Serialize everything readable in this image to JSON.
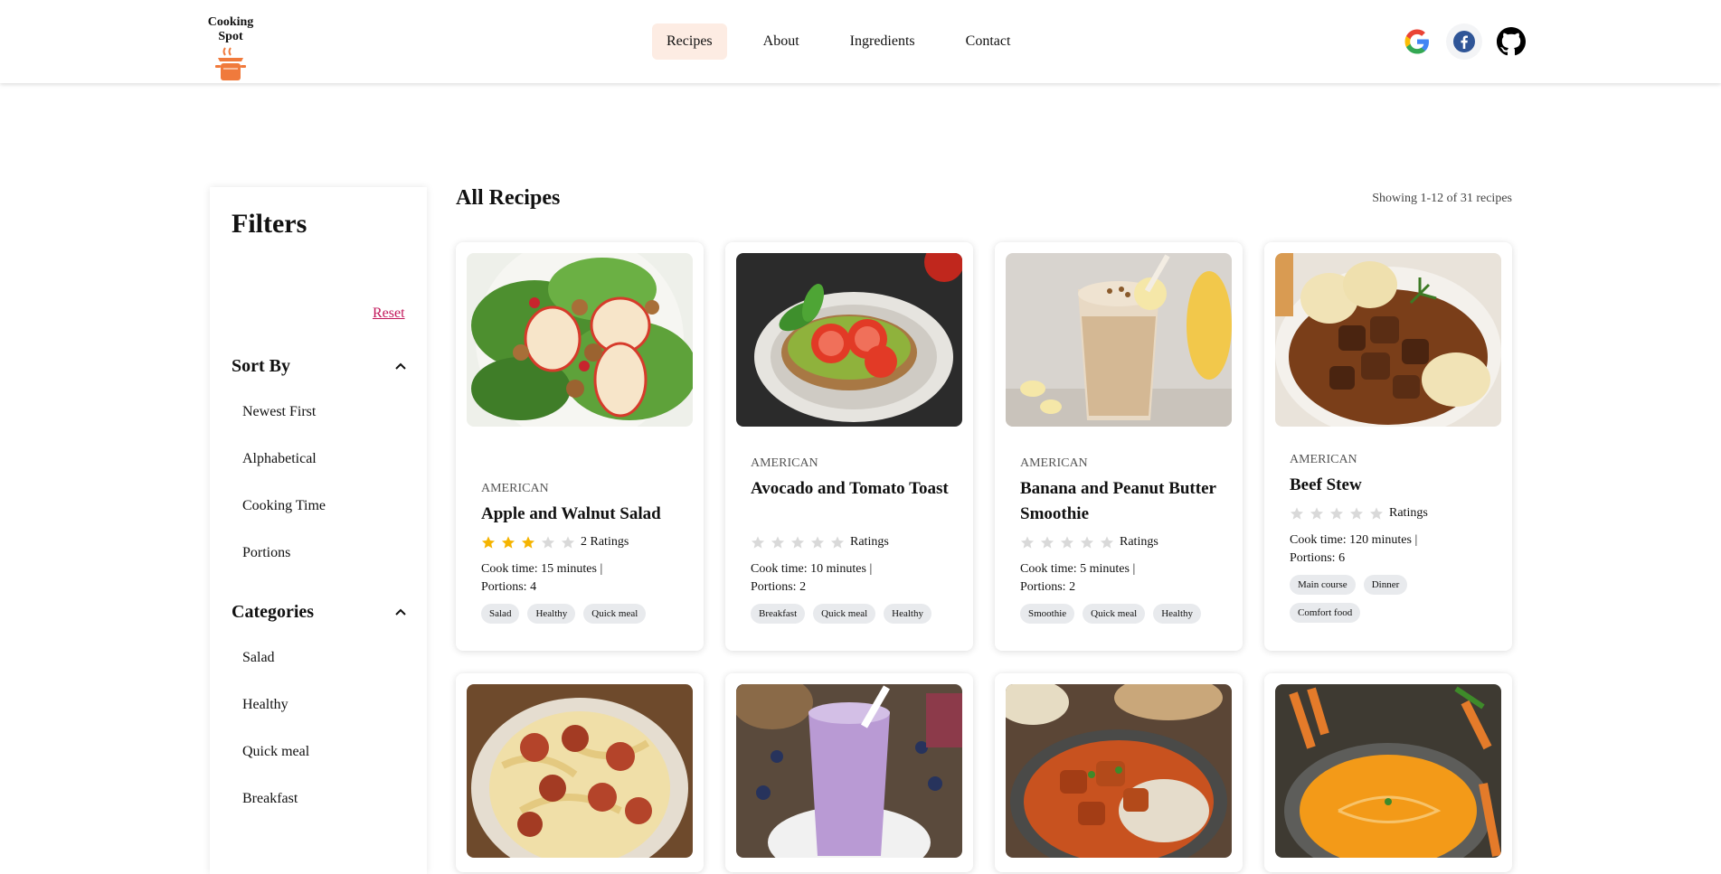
{
  "header": {
    "logo_text": "Cooking Spot",
    "nav": [
      {
        "label": "Recipes",
        "active": true
      },
      {
        "label": "About"
      },
      {
        "label": "Ingredients"
      },
      {
        "label": "Contact"
      }
    ],
    "socials": [
      "google-icon",
      "facebook-icon",
      "github-icon"
    ]
  },
  "sidebar": {
    "title": "Filters",
    "reset": "Reset",
    "sort": {
      "title": "Sort By",
      "options": [
        "Newest First",
        "Alphabetical",
        "Cooking Time",
        "Portions"
      ]
    },
    "categories": {
      "title": "Categories",
      "options": [
        "Salad",
        "Healthy",
        "Quick meal",
        "Breakfast"
      ]
    }
  },
  "main": {
    "title": "All Recipes",
    "showing": "Showing 1-12 of 31 recipes",
    "recipes": [
      {
        "cuisine": "AMERICAN",
        "title": "Apple and Walnut Salad",
        "rating": 3,
        "ratings_label": "2 Ratings",
        "cook_time": "Cook time: 15 minutes |",
        "portions": "Portions: 4",
        "tags": [
          "Salad",
          "Healthy",
          "Quick meal"
        ]
      },
      {
        "cuisine": "AMERICAN",
        "title": "Avocado and Tomato Toast",
        "rating": 0,
        "ratings_label": "Ratings",
        "cook_time": "Cook time: 10 minutes |",
        "portions": "Portions: 2",
        "tags": [
          "Breakfast",
          "Quick meal",
          "Healthy"
        ]
      },
      {
        "cuisine": "AMERICAN",
        "title": "Banana and Peanut Butter Smoothie",
        "rating": 0,
        "ratings_label": "Ratings",
        "cook_time": "Cook time: 5 minutes |",
        "portions": "Portions: 2",
        "tags": [
          "Smoothie",
          "Quick meal",
          "Healthy"
        ]
      },
      {
        "cuisine": "AMERICAN",
        "title": "Beef Stew",
        "rating": 0,
        "ratings_label": "Ratings",
        "cook_time": "Cook time: 120 minutes |",
        "portions": "Portions: 6",
        "tags": [
          "Main course",
          "Dinner",
          "Comfort food"
        ]
      }
    ]
  },
  "colors": {
    "accent": "#f07a3c",
    "active_nav_bg": "#fdece3",
    "reset_link": "#c2185b",
    "star_filled": "#f5b400",
    "star_empty": "#d9d9d9"
  }
}
